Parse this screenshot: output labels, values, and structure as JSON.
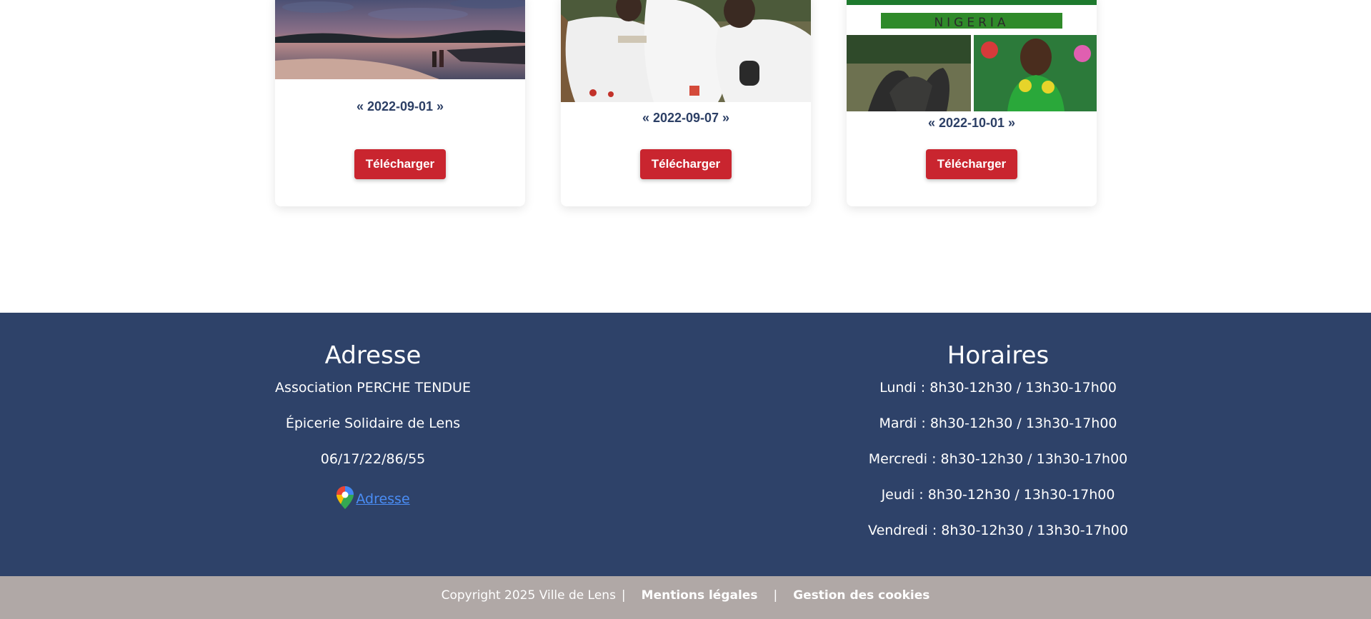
{
  "cards": [
    {
      "image_desc": "beach-sunset",
      "date": "« 2022-09-01 »",
      "button_label": "Télécharger"
    },
    {
      "image_desc": "people-in-white-ceremony",
      "date": "« 2022-09-07 »",
      "button_label": "Télécharger"
    },
    {
      "image_desc": "nigeria-collage",
      "image_caption": "NIGERIA",
      "date": "« 2022-10-01 »",
      "button_label": "Télécharger"
    }
  ],
  "footer": {
    "address": {
      "title": "Adresse",
      "lines": [
        "Association PERCHE TENDUE",
        "Épicerie Solidaire de Lens",
        "06/17/22/86/55"
      ],
      "map_link": "Adresse"
    },
    "hours": {
      "title": "Horaires",
      "lines": [
        "Lundi : 8h30-12h30 / 13h30-17h00",
        "Mardi : 8h30-12h30 / 13h30-17h00",
        "Mercredi : 8h30-12h30 / 13h30-17h00",
        "Jeudi : 8h30-12h30 / 13h30-17h00",
        "Vendredi : 8h30-12h30 / 13h30-17h00"
      ]
    },
    "bottom": {
      "copyright": "Copyright 2025 Ville de Lens",
      "separator": "|",
      "links": [
        "Mentions légales",
        "Gestion des cookies"
      ]
    }
  },
  "colors": {
    "footer_bg": "#2e4269",
    "footer_bottom_bg": "#b0a8a6",
    "button_red": "#c9252f",
    "date_text": "#2c3f65",
    "link_blue": "#4a8df5"
  }
}
